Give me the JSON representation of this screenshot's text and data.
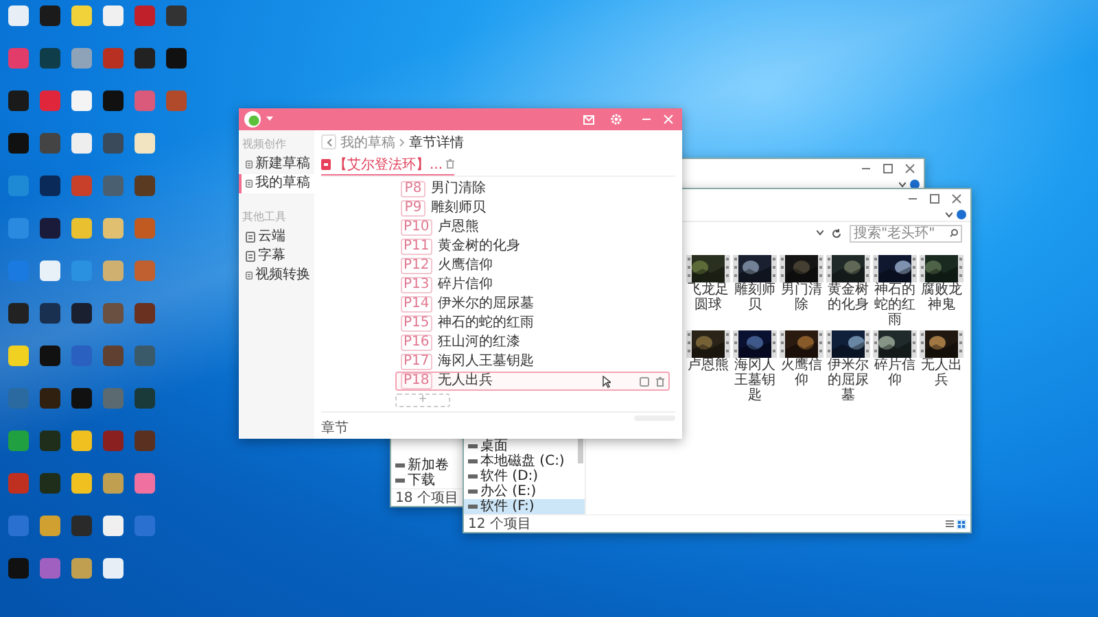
{
  "app": {
    "sidebar": {
      "sections": [
        {
          "title": "视频创作",
          "items": [
            {
              "label": "新建草稿",
              "selected": false
            },
            {
              "label": "我的草稿",
              "selected": true
            }
          ]
        },
        {
          "title": "其他工具",
          "items": [
            {
              "label": "云端",
              "selected": false
            },
            {
              "label": "字幕",
              "selected": false
            },
            {
              "label": "视频转换",
              "selected": false
            }
          ]
        }
      ]
    },
    "breadcrumb": [
      "我的草稿",
      "章节详情"
    ],
    "tab": {
      "label": "【艾尔登法环】..."
    },
    "chapters": [
      {
        "index": "P8",
        "title": "男门清除",
        "selected": false
      },
      {
        "index": "P9",
        "title": "雕刻师贝",
        "selected": false
      },
      {
        "index": "P10",
        "title": "卢恩熊",
        "selected": false
      },
      {
        "index": "P11",
        "title": "黄金树的化身",
        "selected": false
      },
      {
        "index": "P12",
        "title": "火鹰信仰",
        "selected": false
      },
      {
        "index": "P13",
        "title": "碎片信仰",
        "selected": false
      },
      {
        "index": "P14",
        "title": "伊米尔的屈尿墓",
        "selected": false
      },
      {
        "index": "P15",
        "title": "神石的蛇的红雨",
        "selected": false
      },
      {
        "index": "P16",
        "title": "狂山河的红漆",
        "selected": false
      },
      {
        "index": "P17",
        "title": "海冈人王墓钥匙",
        "selected": false
      },
      {
        "index": "P18",
        "title": "无人出兵",
        "selected": true
      }
    ],
    "add_label": "+",
    "footer_label": "章节"
  },
  "explorer_back": {
    "nav": [
      {
        "label": "新加卷"
      },
      {
        "label": "下载"
      }
    ],
    "status": "18 个项目"
  },
  "explorer_front": {
    "search": {
      "placeholder": "搜索\"老头环\""
    },
    "files": [
      {
        "name": "飞龙足圆球"
      },
      {
        "name": "雕刻师贝"
      },
      {
        "name": "男门清除"
      },
      {
        "name": "黄金树的化身"
      },
      {
        "name": "神石的蛇的红雨"
      },
      {
        "name": "腐败龙神鬼"
      },
      {
        "name": "卢恩熊"
      },
      {
        "name": "海冈人王墓钥匙"
      },
      {
        "name": "火鹰信仰"
      },
      {
        "name": "伊米尔的屈尿墓"
      },
      {
        "name": "碎片信仰"
      },
      {
        "name": "无人出兵"
      }
    ],
    "nav": [
      {
        "label": "桌面",
        "selected": false
      },
      {
        "label": "本地磁盘 (C:)",
        "selected": false
      },
      {
        "label": "软件 (D:)",
        "selected": false
      },
      {
        "label": "办公 (E:)",
        "selected": false
      },
      {
        "label": "软件 (F:)",
        "selected": true
      }
    ],
    "status": "12 个项目"
  }
}
